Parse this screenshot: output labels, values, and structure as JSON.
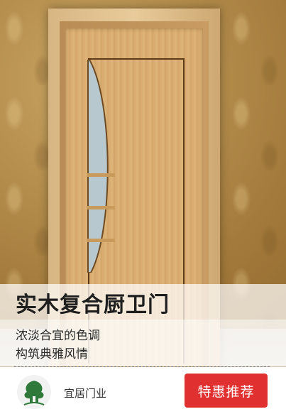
{
  "product": {
    "title": "实木复合厨卫门",
    "description_lines": [
      "浓淡合宜的色调",
      "构筑典雅风情"
    ]
  },
  "brand": {
    "name": "宜居门业",
    "logo_icon": "tree-logo-icon",
    "logo_color": "#2f7a3a"
  },
  "promo_button": {
    "label": "特惠推荐",
    "color": "#e0302f"
  }
}
